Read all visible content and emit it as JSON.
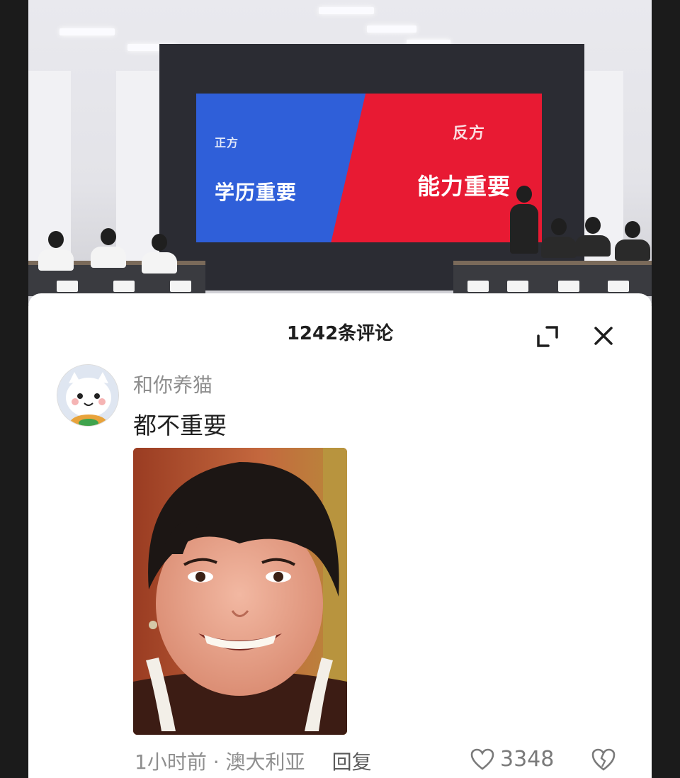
{
  "video": {
    "screen": {
      "left_side_label": "正方",
      "left_thesis": "学历重要",
      "right_side_label": "反方",
      "right_thesis": "能力重要",
      "left_color": "#2f5fd9",
      "right_color": "#e81a33"
    }
  },
  "comments_panel": {
    "title": "1242条评论",
    "expand_icon": "expand-icon",
    "close_icon": "close-icon"
  },
  "comment": {
    "username": "和你养猫",
    "text": "都不重要",
    "time": "1小时前",
    "separator": "·",
    "location": "澳大利亚",
    "reply_label": "回复",
    "like_count": "3348",
    "like_icon": "heart-outline-icon",
    "dislike_icon": "broken-heart-icon"
  }
}
